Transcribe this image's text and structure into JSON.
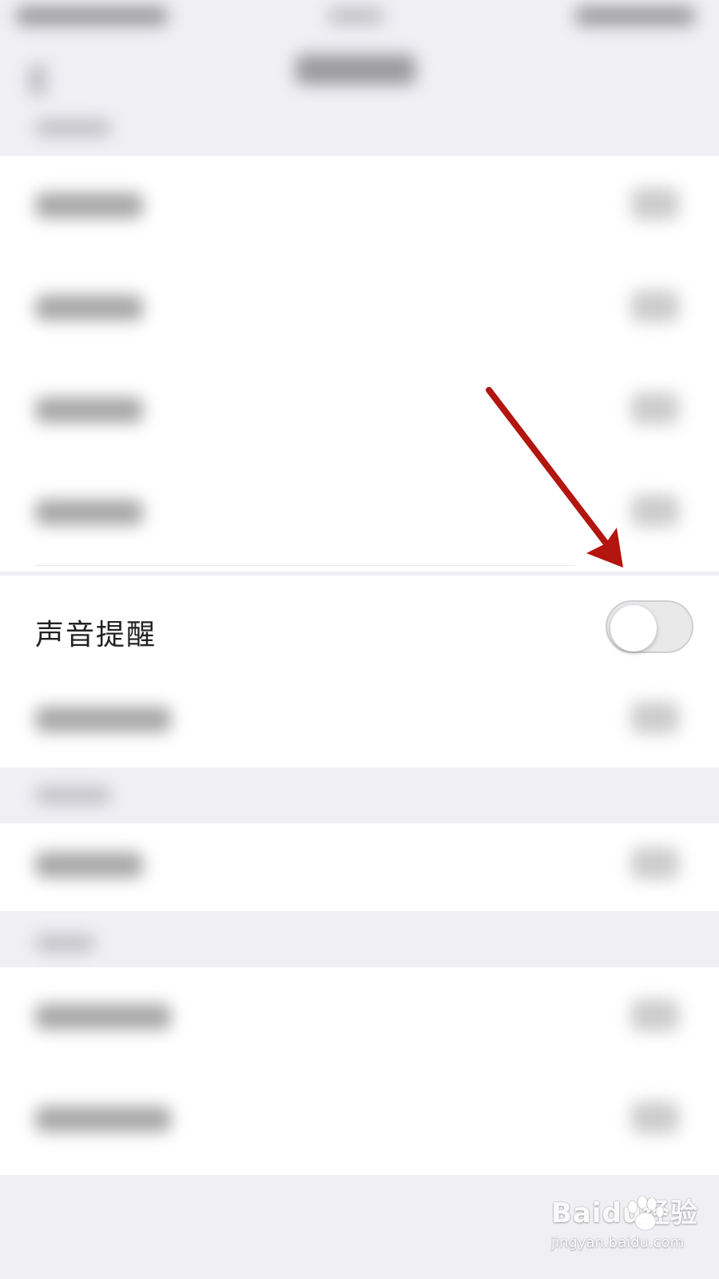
{
  "settings": {
    "sound_reminder_label": "声音提醒",
    "sound_reminder_enabled": false
  },
  "colors": {
    "background": "#efeff4",
    "toggle_off": "#e9e9ea",
    "annotation_arrow": "#b3150f"
  },
  "watermark": {
    "brand": "Baidu经验",
    "url": "jingyan.baidu.com"
  }
}
